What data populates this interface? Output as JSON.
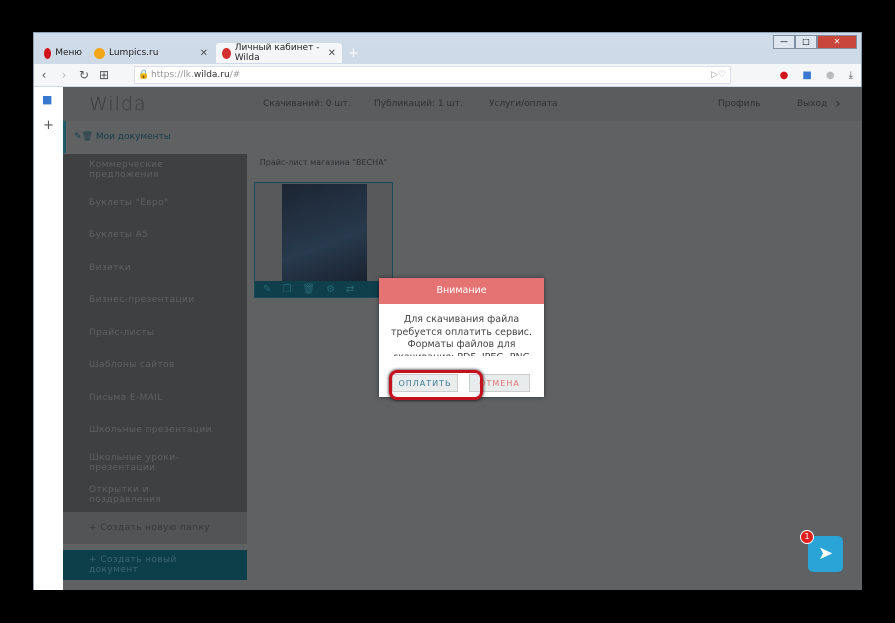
{
  "browser": {
    "tabs": [
      {
        "label": "Меню"
      },
      {
        "label": "Lumpics.ru"
      },
      {
        "label": "Личный кабинет - Wilda"
      }
    ],
    "url_prefix": "https://lk.",
    "url_host": "wilda.ru",
    "url_suffix": "/#"
  },
  "header": {
    "logo": "Wilda",
    "downloads": "Скачиваний: 0 шт.",
    "publications": "Публикаций: 1 шт.",
    "services": "Услуги/оплата",
    "profile": "Профиль",
    "logout": "Выход"
  },
  "breadcrumb": "Мои документы",
  "sidebar": {
    "items": [
      "Коммерческие предложения",
      "Буклеты \"Евро\"",
      "Буклеты А5",
      "Визитки",
      "Бизнес-презентации",
      "Прайс-листы",
      "Шаблоны сайтов",
      "Письма E-MAIL",
      "Школьные презентации",
      "Школьные уроки-презентации",
      "Открытки и поздравления"
    ],
    "new_folder": "+ Создать новую папку",
    "new_document": "+ Создать новый документ"
  },
  "document": {
    "title": "Прайс-лист магазина \"ВЕСНА\""
  },
  "dialog": {
    "title": "Внимание",
    "body": "Для скачивания файла требуется оплатить сервис. Форматы файлов для скачивания: PDF, JPEG, PNG",
    "pay": "ОПЛАТИТЬ",
    "cancel": "ОТМЕНА"
  },
  "chat": {
    "badge": "1"
  }
}
